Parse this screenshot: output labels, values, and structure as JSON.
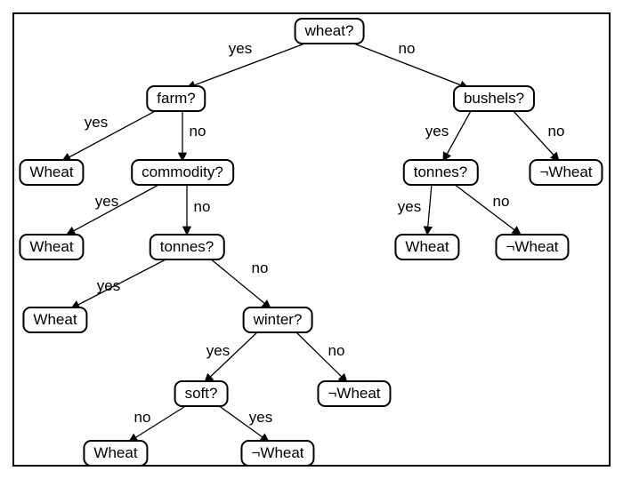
{
  "tree": {
    "root": {
      "label": "wheat?",
      "left_lbl": "yes",
      "right_lbl": "no"
    },
    "farm": {
      "label": "farm?",
      "left_lbl": "yes",
      "right_lbl": "no"
    },
    "bushels": {
      "label": "bushels?",
      "left_lbl": "yes",
      "right_lbl": "no"
    },
    "leaf_wheat_1": {
      "label": "Wheat"
    },
    "commodity": {
      "label": "commodity?",
      "left_lbl": "yes",
      "right_lbl": "no"
    },
    "tonnes_r": {
      "label": "tonnes?",
      "left_lbl": "yes",
      "right_lbl": "no"
    },
    "leaf_notwheat_1": {
      "label": "¬Wheat"
    },
    "leaf_wheat_2": {
      "label": "Wheat"
    },
    "tonnes_l": {
      "label": "tonnes?",
      "left_lbl": "yes",
      "right_lbl": "no"
    },
    "leaf_wheat_r": {
      "label": "Wheat"
    },
    "leaf_notwheat_r": {
      "label": "¬Wheat"
    },
    "leaf_wheat_3": {
      "label": "Wheat"
    },
    "winter": {
      "label": "winter?",
      "left_lbl": "yes",
      "right_lbl": "no"
    },
    "soft": {
      "label": "soft?",
      "left_lbl": "no",
      "right_lbl": "yes"
    },
    "leaf_notwheat_2": {
      "label": "¬Wheat"
    },
    "leaf_wheat_4": {
      "label": "Wheat"
    },
    "leaf_notwheat_3": {
      "label": "¬Wheat"
    }
  }
}
